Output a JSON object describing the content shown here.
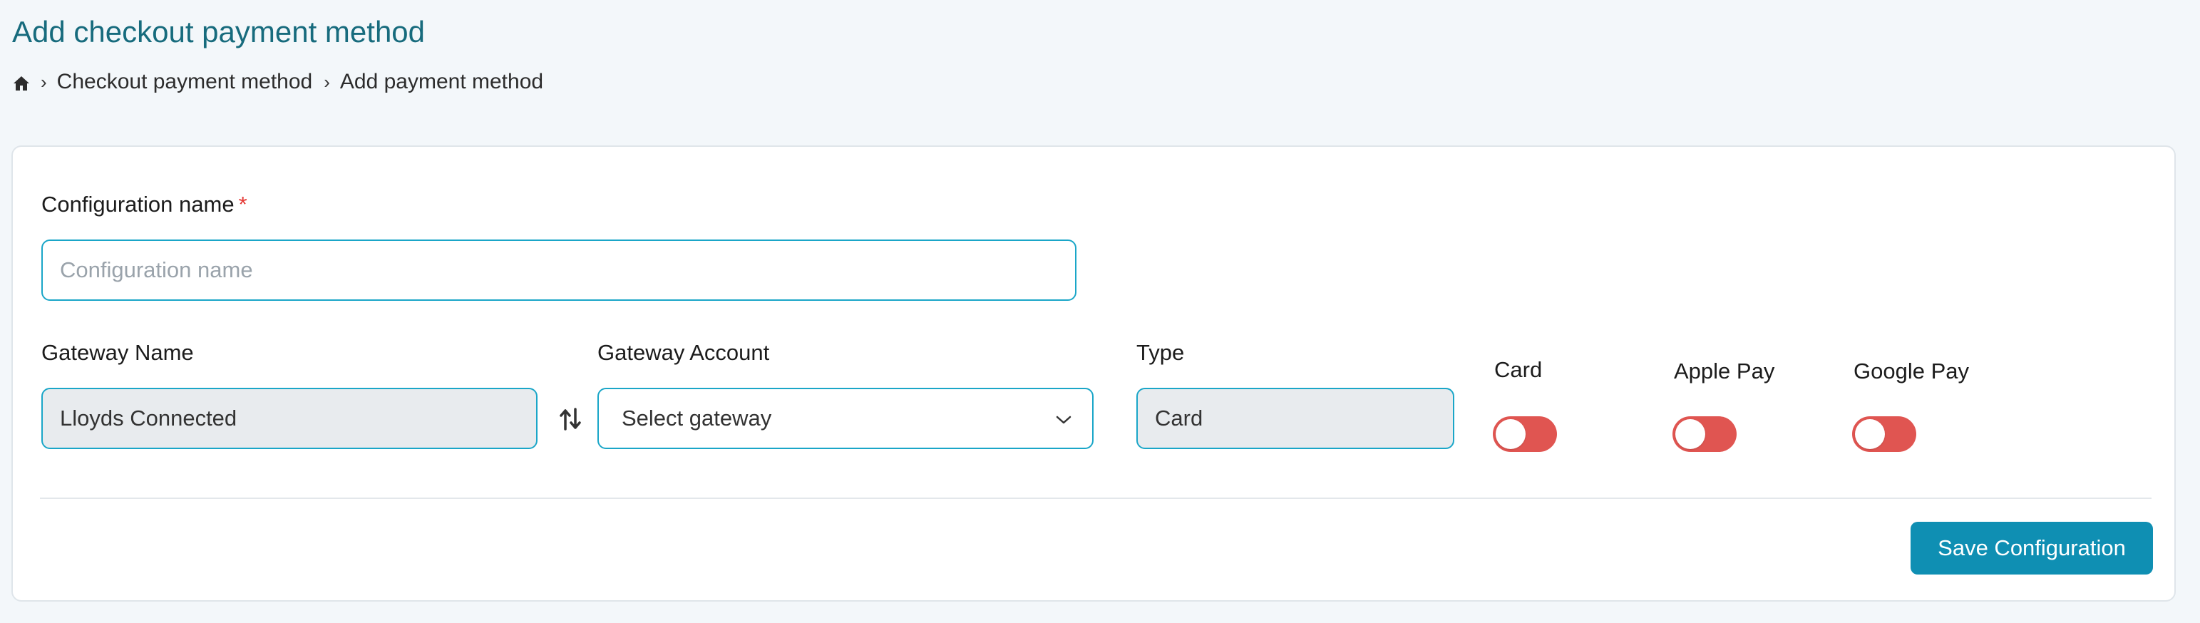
{
  "header": {
    "title": "Add checkout payment method",
    "breadcrumb": {
      "home_icon": "home-icon",
      "items": [
        "Checkout payment method",
        "Add payment method"
      ]
    }
  },
  "form": {
    "config_name": {
      "label": "Configuration name",
      "required_marker": "*",
      "placeholder": "Configuration name",
      "value": ""
    },
    "gateway_name": {
      "label": "Gateway Name",
      "value": "Lloyds Connected"
    },
    "swap_icon": "swap-vertical-icon",
    "gateway_account": {
      "label": "Gateway Account",
      "value": "Select gateway"
    },
    "type": {
      "label": "Type",
      "value": "Card"
    },
    "toggles": [
      {
        "label": "Card",
        "enabled": false
      },
      {
        "label": "Apple Pay",
        "enabled": false
      },
      {
        "label": "Google Pay",
        "enabled": false
      }
    ],
    "save_label": "Save Configuration"
  },
  "colors": {
    "accent": "#0f8fb3",
    "title": "#176b7d",
    "toggle_off": "#e05551",
    "required": "#e53935",
    "input_border": "#1aa6c8"
  }
}
